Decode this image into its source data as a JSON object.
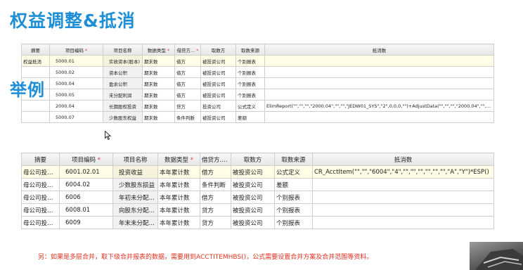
{
  "slide": {
    "title": "权益调整&抵消",
    "example_label": "举例",
    "note": "另：如果是多层合并，取下级合并报表的数据，需要用到ACCTITEMHBS()，公式需要设置合并方案及合并范围等资料。"
  },
  "table1": {
    "columns": [
      {
        "label": "摘要",
        "required": false
      },
      {
        "label": "项目编码",
        "required": true
      },
      {
        "label": "项目名称",
        "required": false
      },
      {
        "label": "数据类型",
        "required": true
      },
      {
        "label": "借贷方...",
        "required": true
      },
      {
        "label": "取数方",
        "required": false
      },
      {
        "label": "取数来源",
        "required": false
      },
      {
        "label": "抵消数",
        "required": false
      }
    ],
    "rows": [
      {
        "summary": "权益抵消",
        "code": "5000.01",
        "name": "实收资本(股本)",
        "type": "期末数",
        "dc": "借方",
        "party": "被投资公司",
        "source": "个别报表",
        "formula": ""
      },
      {
        "summary": "",
        "code": "5000.02",
        "name": "资本公积",
        "type": "期末数",
        "dc": "借方",
        "party": "被投资公司",
        "source": "个别报表",
        "formula": ""
      },
      {
        "summary": "",
        "code": "5000.04",
        "name": "盈余公积",
        "type": "期末数",
        "dc": "借方",
        "party": "被投资公司",
        "source": "个别报表",
        "formula": ""
      },
      {
        "summary": "",
        "code": "5000.05",
        "name": "未分配利润",
        "type": "期末数",
        "dc": "借方",
        "party": "被投资公司",
        "source": "个别报表",
        "formula": ""
      },
      {
        "summary": "",
        "code": "2000.04",
        "name": "长期股权投资",
        "type": "期末数",
        "dc": "贷方",
        "party": "投资公司",
        "source": "公式定义",
        "formula": "ElimReport(\"\",\"\",\"\",\"2000.04\",\"\",\"\",\"JEDW01_SYS\",\"2\",0,0,0,\"\")+AdjustData(\"\",\"\",\"\",\"2000.04\",\"\",\"\",\"JEDW01_SYS\",..."
      },
      {
        "summary": "",
        "code": "5000.07",
        "name": "少数股东权益",
        "type": "期末数",
        "dc": "条件判断",
        "party": "被投资公司",
        "source": "差额",
        "formula": ""
      }
    ]
  },
  "table2": {
    "columns": [
      {
        "label": "摘要",
        "required": false
      },
      {
        "label": "项目编码",
        "required": true
      },
      {
        "label": "项目名称",
        "required": false
      },
      {
        "label": "数据类型",
        "required": true
      },
      {
        "label": "借贷方...",
        "required": true
      },
      {
        "label": "取数方",
        "required": false
      },
      {
        "label": "取数来源",
        "required": false
      },
      {
        "label": "抵消数",
        "required": false
      }
    ],
    "rows": [
      {
        "summary": "母公司投资...",
        "code": "6001.02.01",
        "name": "投资收益",
        "type": "本年累计数",
        "dc": "借方",
        "party": "被投资公司",
        "source": "公式定义",
        "formula": "CR_AcctItem(\"\",\"\",\"6004\",\"4\",\"\",\"\",\"\",\"\",\"\",\"\",\"A\",\"Y\")*ESP()"
      },
      {
        "summary": "母公司投资...",
        "code": "6004.02",
        "name": "少数股东损益",
        "type": "本年累计数",
        "dc": "条件判断",
        "party": "被投资公司",
        "source": "差额",
        "formula": ""
      },
      {
        "summary": "母公司投资...",
        "code": "6006",
        "name": "年初未分配利润",
        "type": "本年累计数",
        "dc": "借方",
        "party": "被投资公司",
        "source": "个别报表",
        "formula": ""
      },
      {
        "summary": "母公司投资...",
        "code": "6008.01",
        "name": "向股东分配利润",
        "type": "本年累计数",
        "dc": "贷方",
        "party": "被投资公司",
        "source": "个别报表",
        "formula": ""
      },
      {
        "summary": "母公司投资...",
        "code": "6009",
        "name": "年末未分配利润",
        "type": "本年累计数",
        "dc": "贷方",
        "party": "被投资公司",
        "source": "个别报表",
        "formula": ""
      }
    ]
  },
  "colors": {
    "title": "#1e8fd6",
    "note": "#e0321f",
    "required_mark": "#d9363e",
    "highlight_row": "#fffde6"
  },
  "icons": {
    "cursor": "mouse-pointer-icon"
  }
}
